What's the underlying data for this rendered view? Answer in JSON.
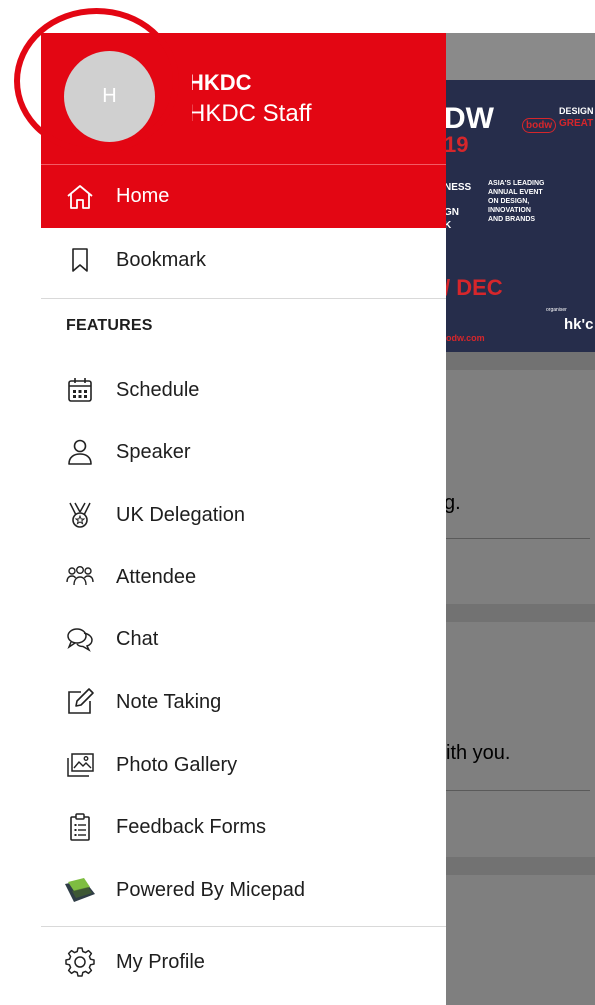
{
  "background": {
    "banner": {
      "line1": "DW",
      "line2": "19",
      "badge": "bodw",
      "design_is": "DESIGN IS",
      "great": "GREAT",
      "ness": "NESS",
      "gn": "GN",
      "k": "K",
      "leading": "ASIA'S LEADING",
      "annual": "ANNUAL EVENT",
      "design": "ON DESIGN,",
      "innovation": "INNOVATION",
      "brands": "AND BRANDS",
      "dec": "/ DEC",
      "organiser": "organiser",
      "hkdc_logo": "hk'c",
      "site": "odw.com"
    },
    "card1_text": "g.",
    "card2_text": "ith you."
  },
  "drawer": {
    "avatar_initial": "H",
    "user_name": "HKDC",
    "user_role": "HKDC Staff",
    "home": "Home",
    "bookmark": "Bookmark",
    "section_features": "FEATURES",
    "items": [
      {
        "label": "Schedule",
        "icon": "calendar-icon"
      },
      {
        "label": "Speaker",
        "icon": "person-icon"
      },
      {
        "label": "UK Delegation",
        "icon": "medal-icon"
      },
      {
        "label": "Attendee",
        "icon": "group-icon"
      },
      {
        "label": "Chat",
        "icon": "chat-icon"
      },
      {
        "label": "Note Taking",
        "icon": "edit-icon"
      },
      {
        "label": "Photo Gallery",
        "icon": "gallery-icon"
      },
      {
        "label": "Feedback Forms",
        "icon": "clipboard-icon"
      },
      {
        "label": "Powered By Micepad",
        "icon": "micepad-logo-icon"
      }
    ],
    "my_profile": "My Profile"
  },
  "colors": {
    "accent": "#e30613",
    "overlay": "#7f7f7f"
  }
}
